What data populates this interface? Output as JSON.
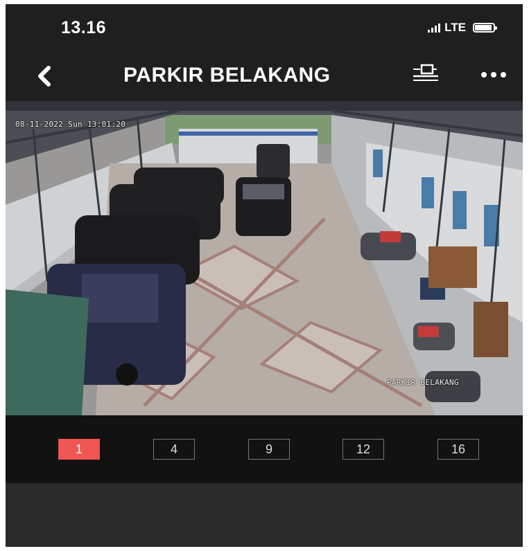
{
  "status_bar": {
    "time": "13.16",
    "network": "LTE"
  },
  "header": {
    "title": "PARKIR BELAKANG",
    "back_icon": "chevron-left-icon",
    "screen_icon": "screen-cast-icon",
    "more_icon": "more-horizontal-icon"
  },
  "video": {
    "timestamp": "08-11-2022 Sun 13:01:20",
    "camera_name": "PARKIR BELAKANG"
  },
  "view_modes": {
    "items": [
      "1",
      "4",
      "9",
      "12",
      "16"
    ],
    "selected": "1",
    "active_color": "#f05552"
  }
}
